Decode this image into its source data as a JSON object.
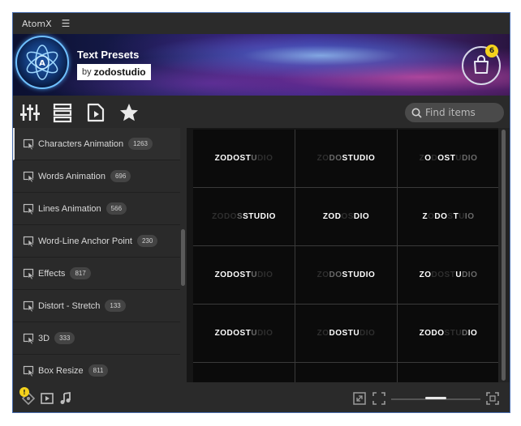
{
  "titlebar": {
    "title": "AtomX",
    "menu_icon": "hamburger-icon"
  },
  "banner": {
    "title": "Text Presets",
    "by": "by",
    "brand": "zodostudio",
    "cart_icon": "shopping-bag-icon",
    "cart_count": "6"
  },
  "toolbar": {
    "tools": [
      "sliders-icon",
      "list-icon",
      "play-file-icon",
      "star-icon"
    ],
    "search_placeholder": "Find items"
  },
  "sidebar": {
    "items": [
      {
        "label": "Characters Animation",
        "count": "1263"
      },
      {
        "label": "Words Animation",
        "count": "696"
      },
      {
        "label": "Lines Animation",
        "count": "566"
      },
      {
        "label": "Word-Line Anchor Point",
        "count": "230"
      },
      {
        "label": "Effects",
        "count": "817"
      },
      {
        "label": "Distort - Stretch",
        "count": "133"
      },
      {
        "label": "3D",
        "count": "333"
      },
      {
        "label": "Box Resize",
        "count": "811"
      }
    ]
  },
  "grid": {
    "cells": [
      [
        [
          "ZODOST",
          "t1"
        ],
        [
          "U",
          "t2"
        ],
        [
          "DIO",
          "t3"
        ]
      ],
      [
        [
          "ZO",
          "t3"
        ],
        [
          "DO",
          "t2"
        ],
        [
          "STUDIO",
          "t1"
        ]
      ],
      [
        [
          "Z",
          "t3"
        ],
        [
          "O",
          "t1"
        ],
        [
          "D",
          "t3"
        ],
        [
          "OST",
          "t1"
        ],
        [
          "U",
          "t3"
        ],
        [
          "DIO",
          "t2"
        ]
      ],
      [
        [
          "ZODO",
          "t3"
        ],
        [
          "S",
          "t2"
        ],
        [
          "STUDIO",
          "t1"
        ]
      ],
      [
        [
          "ZOD",
          "t1"
        ],
        [
          "O",
          "t3"
        ],
        [
          "S",
          "t3"
        ],
        [
          "DIO",
          "t1"
        ]
      ],
      [
        [
          "Z",
          "t1"
        ],
        [
          "O",
          "t3"
        ],
        [
          "DO",
          "t1"
        ],
        [
          "S",
          "t3"
        ],
        [
          "T",
          "t1"
        ],
        [
          "U",
          "t3"
        ],
        [
          "IO",
          "t2"
        ]
      ],
      [
        [
          "ZODOST",
          "t1"
        ],
        [
          "U",
          "t2"
        ],
        [
          "DIO",
          "t3"
        ]
      ],
      [
        [
          "ZO",
          "t3"
        ],
        [
          "DO",
          "t2"
        ],
        [
          "STUDIO",
          "t1"
        ]
      ],
      [
        [
          "ZO",
          "t1"
        ],
        [
          "DOST",
          "t3"
        ],
        [
          "U",
          "t1"
        ],
        [
          "DIO",
          "t2"
        ]
      ],
      [
        [
          "ZODOST",
          "t1"
        ],
        [
          "U",
          "t2"
        ],
        [
          "DIO",
          "t3"
        ]
      ],
      [
        [
          "ZO",
          "t3"
        ],
        [
          "DOSTU",
          "t1"
        ],
        [
          "DIO",
          "t3"
        ]
      ],
      [
        [
          "ZODO",
          "t1"
        ],
        [
          "ST",
          "t3"
        ],
        [
          "U",
          "t3"
        ],
        [
          "D",
          "t2"
        ],
        [
          "IO",
          "t1"
        ]
      ],
      [
        [
          "",
          "t1"
        ]
      ],
      [
        [
          "",
          "t1"
        ]
      ],
      [
        [
          "",
          "t1"
        ]
      ]
    ]
  },
  "footer": {
    "left_icons": [
      "puzzle-icon",
      "video-icon",
      "music-note-icon"
    ],
    "warning": "!",
    "right_icons": [
      "expand-icon",
      "fit-icon",
      "fullscreen-icon"
    ],
    "zoom_level": 0.5
  },
  "colors": {
    "accent": "#f4d21c",
    "window_border": "#4a6fb0",
    "background": "#232323"
  }
}
